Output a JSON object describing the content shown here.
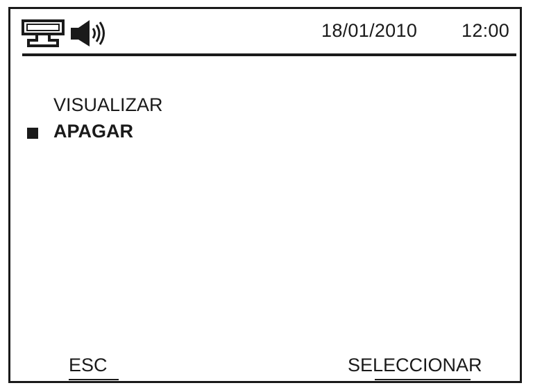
{
  "status_bar": {
    "icons": [
      "network-icon",
      "speaker-icon"
    ],
    "date": "18/01/2010",
    "time": "12:00"
  },
  "menu": {
    "items": [
      {
        "label": "VISUALIZAR",
        "selected": false
      },
      {
        "label": "APAGAR",
        "selected": true
      }
    ]
  },
  "softkeys": {
    "left_label": "ESC",
    "right_label": "SELECCIONAR"
  }
}
